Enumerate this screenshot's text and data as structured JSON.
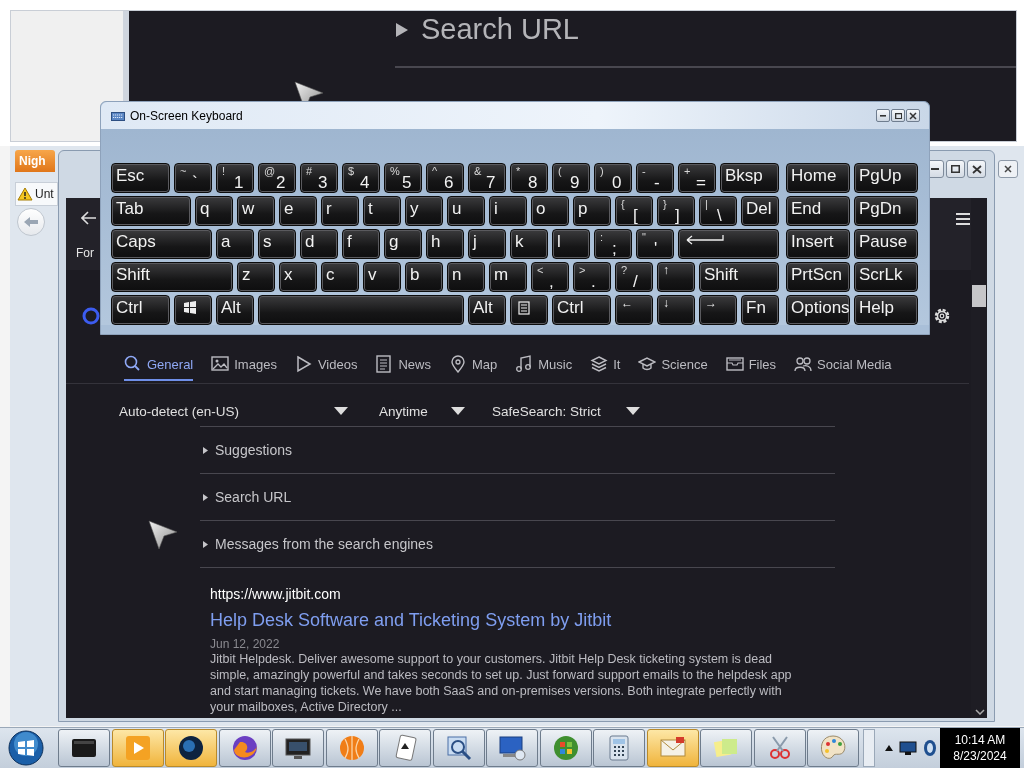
{
  "background_window": {
    "section": {
      "label": "Search URL",
      "expanded": false
    }
  },
  "browser": {
    "menu_tab": {
      "label": "Nigh"
    },
    "page_tab": {
      "label": "Unt"
    }
  },
  "search_page": {
    "header_text": "For",
    "tabs": [
      {
        "label": "General",
        "kind": "search",
        "selected": true
      },
      {
        "label": "Images",
        "kind": "image",
        "selected": false
      },
      {
        "label": "Videos",
        "kind": "video",
        "selected": false
      },
      {
        "label": "News",
        "kind": "news",
        "selected": false
      },
      {
        "label": "Map",
        "kind": "map",
        "selected": false
      },
      {
        "label": "Music",
        "kind": "music",
        "selected": false
      },
      {
        "label": "It",
        "kind": "layers",
        "selected": false
      },
      {
        "label": "Science",
        "kind": "science",
        "selected": false
      },
      {
        "label": "Files",
        "kind": "files",
        "selected": false
      },
      {
        "label": "Social Media",
        "kind": "people",
        "selected": false
      }
    ],
    "filters": [
      {
        "label": "Auto-detect (en-US)"
      },
      {
        "label": "Anytime"
      },
      {
        "label": "SafeSearch: Strict"
      }
    ],
    "sections": [
      {
        "label": "Suggestions",
        "expanded": false
      },
      {
        "label": "Search URL",
        "expanded": false
      },
      {
        "label": "Messages from the search engines",
        "expanded": false
      }
    ],
    "result": {
      "url": "https://www.jitbit.com",
      "title": "Help Desk Software and Ticketing System by Jitbit",
      "date": "Jun 12, 2022",
      "snippet": "Jitbit Helpdesk. Deliver awesome support to your customers. Jitbit Help Desk ticketing system is dead simple, amazingly powerful and takes seconds to set up. Just forward support emails to the helpdesk app and start managing tickets. We have both SaaS and on-premises versions. Both integrate perfectly with your mailboxes, Active Directory ..."
    }
  },
  "keyboard": {
    "title": "On-Screen Keyboard",
    "rows": [
      {
        "keys": [
          {
            "kind": "text",
            "label": "Esc"
          },
          {
            "kind": "dual",
            "top": "~",
            "main": "`"
          },
          {
            "kind": "dual",
            "top": "!",
            "main": "1"
          },
          {
            "kind": "dual",
            "top": "@",
            "main": "2"
          },
          {
            "kind": "dual",
            "top": "#",
            "main": "3"
          },
          {
            "kind": "dual",
            "top": "$",
            "main": "4"
          },
          {
            "kind": "dual",
            "top": "%",
            "main": "5"
          },
          {
            "kind": "dual",
            "top": "^",
            "main": "6"
          },
          {
            "kind": "dual",
            "top": "&",
            "main": "7"
          },
          {
            "kind": "dual",
            "top": "*",
            "main": "8"
          },
          {
            "kind": "dual",
            "top": "(",
            "main": "9"
          },
          {
            "kind": "dual",
            "top": ")",
            "main": "0"
          },
          {
            "kind": "dual",
            "top": "-",
            "main": "-"
          },
          {
            "kind": "dual",
            "top": "+",
            "main": "="
          },
          {
            "kind": "text",
            "label": "Bksp"
          }
        ]
      },
      {
        "keys": [
          {
            "kind": "text",
            "label": "Tab"
          },
          {
            "kind": "text",
            "label": "q"
          },
          {
            "kind": "text",
            "label": "w"
          },
          {
            "kind": "text",
            "label": "e"
          },
          {
            "kind": "text",
            "label": "r"
          },
          {
            "kind": "text",
            "label": "t"
          },
          {
            "kind": "text",
            "label": "y"
          },
          {
            "kind": "text",
            "label": "u"
          },
          {
            "kind": "text",
            "label": "i"
          },
          {
            "kind": "text",
            "label": "o"
          },
          {
            "kind": "text",
            "label": "p"
          },
          {
            "kind": "dual",
            "top": "{",
            "main": "["
          },
          {
            "kind": "dual",
            "top": "}",
            "main": "]"
          },
          {
            "kind": "dual",
            "top": "|",
            "main": "\\"
          },
          {
            "kind": "text",
            "label": "Del"
          }
        ]
      },
      {
        "keys": [
          {
            "kind": "text",
            "label": "Caps"
          },
          {
            "kind": "text",
            "label": "a"
          },
          {
            "kind": "text",
            "label": "s"
          },
          {
            "kind": "text",
            "label": "d"
          },
          {
            "kind": "text",
            "label": "f"
          },
          {
            "kind": "text",
            "label": "g"
          },
          {
            "kind": "text",
            "label": "h"
          },
          {
            "kind": "text",
            "label": "j"
          },
          {
            "kind": "text",
            "label": "k"
          },
          {
            "kind": "text",
            "label": "l"
          },
          {
            "kind": "dual",
            "top": ":",
            "main": ";"
          },
          {
            "kind": "dual",
            "top": "\"",
            "main": "'"
          },
          {
            "kind": "enter"
          }
        ]
      },
      {
        "keys": [
          {
            "kind": "text",
            "label": "Shift"
          },
          {
            "kind": "text",
            "label": "z"
          },
          {
            "kind": "text",
            "label": "x"
          },
          {
            "kind": "text",
            "label": "c"
          },
          {
            "kind": "text",
            "label": "v"
          },
          {
            "kind": "text",
            "label": "b"
          },
          {
            "kind": "text",
            "label": "n"
          },
          {
            "kind": "text",
            "label": "m"
          },
          {
            "kind": "dual",
            "top": "<",
            "main": ","
          },
          {
            "kind": "dual",
            "top": ">",
            "main": "."
          },
          {
            "kind": "dual",
            "top": "?",
            "main": "/"
          },
          {
            "kind": "arrow",
            "label": "↑"
          },
          {
            "kind": "text",
            "label": "Shift"
          }
        ]
      },
      {
        "keys": [
          {
            "kind": "text",
            "label": "Ctrl"
          },
          {
            "kind": "windows"
          },
          {
            "kind": "text",
            "label": "Alt"
          },
          {
            "kind": "space"
          },
          {
            "kind": "text",
            "label": "Alt"
          },
          {
            "kind": "menu"
          },
          {
            "kind": "text",
            "label": "Ctrl"
          },
          {
            "kind": "arrow",
            "label": "←"
          },
          {
            "kind": "arrow",
            "label": "↓"
          },
          {
            "kind": "arrow",
            "label": "→"
          },
          {
            "kind": "text",
            "label": "Fn"
          }
        ]
      }
    ],
    "side_keys": [
      {
        "label": "Home"
      },
      {
        "label": "PgUp"
      },
      {
        "label": "End"
      },
      {
        "label": "PgDn"
      },
      {
        "label": "Insert"
      },
      {
        "label": "Pause"
      },
      {
        "label": "PrtScn"
      },
      {
        "label": "ScrLk"
      },
      {
        "label": "Options"
      },
      {
        "label": "Help"
      }
    ]
  },
  "taskbar": {
    "buttons": [
      {
        "active": false
      },
      {
        "active": true
      },
      {
        "active": true
      },
      {
        "active": false
      },
      {
        "active": false
      },
      {
        "active": false
      },
      {
        "active": false
      },
      {
        "active": false
      },
      {
        "active": false
      },
      {
        "active": false
      },
      {
        "active": false
      },
      {
        "active": true
      },
      {
        "active": false
      },
      {
        "active": false
      },
      {
        "active": false
      }
    ],
    "clock": {
      "time": "10:14 AM",
      "date": "8/23/2024"
    }
  }
}
